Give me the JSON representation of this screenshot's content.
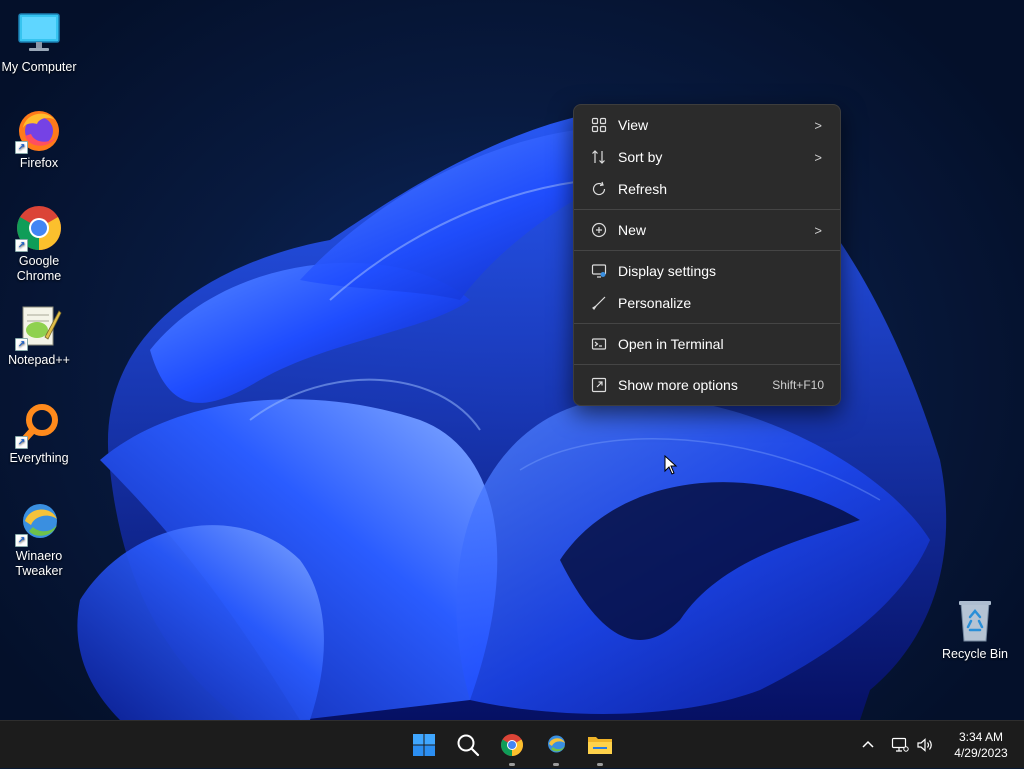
{
  "desktop": {
    "icons": [
      {
        "label": "My Computer",
        "icon": "monitor-icon"
      },
      {
        "label": "Firefox",
        "icon": "firefox-icon"
      },
      {
        "label": "Google Chrome",
        "icon": "chrome-icon"
      },
      {
        "label": "Notepad++",
        "icon": "notepad-icon"
      },
      {
        "label": "Everything",
        "icon": "search-magnifier-icon"
      },
      {
        "label": "Winaero Tweaker",
        "icon": "winaero-icon"
      },
      {
        "label": "Recycle Bin",
        "icon": "recycle-bin-icon"
      }
    ]
  },
  "context_menu": {
    "items": [
      {
        "label": "View",
        "icon": "grid-icon",
        "submenu": true
      },
      {
        "label": "Sort by",
        "icon": "sort-icon",
        "submenu": true
      },
      {
        "label": "Refresh",
        "icon": "refresh-icon"
      },
      {
        "label": "New",
        "icon": "plus-circle-icon",
        "submenu": true
      },
      {
        "label": "Display settings",
        "icon": "display-icon"
      },
      {
        "label": "Personalize",
        "icon": "brush-icon"
      },
      {
        "label": "Open in Terminal",
        "icon": "terminal-icon"
      },
      {
        "label": "Show more options",
        "icon": "more-options-icon",
        "shortcut": "Shift+F10"
      }
    ]
  },
  "taskbar": {
    "apps": [
      "start-icon",
      "search-icon",
      "chrome-icon",
      "winaero-icon",
      "file-explorer-icon"
    ],
    "tray_icons": [
      "chevron-up-icon",
      "network-icon",
      "volume-icon"
    ],
    "clock": {
      "time": "3:34 AM",
      "date": "4/29/2023"
    }
  },
  "colors": {
    "menu_bg": "#2b2b2b",
    "taskbar_bg": "#1c1c1c",
    "accent": "#1d5cff"
  }
}
